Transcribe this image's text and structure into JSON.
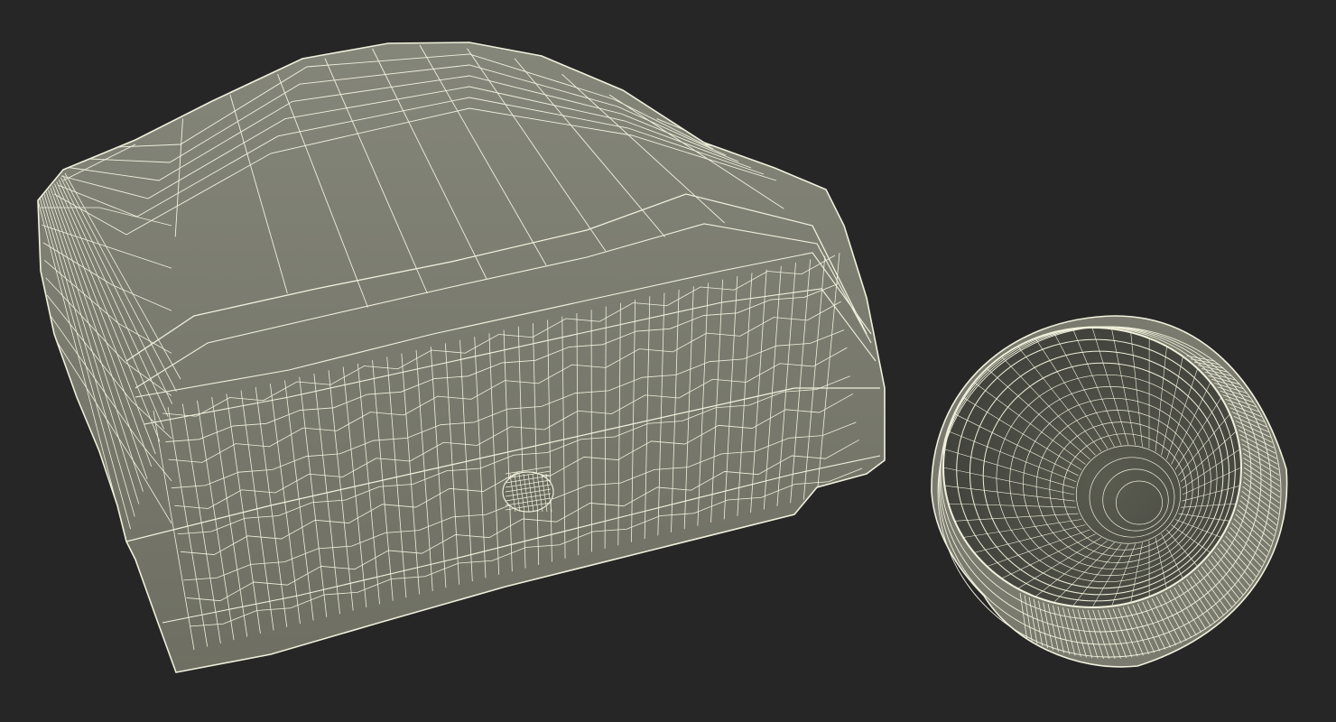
{
  "scene": {
    "background_color": "#262626",
    "surface_color": "#7d7e70",
    "surface_shadow_color": "#5e5f53",
    "wire_color": "#f0f0dc",
    "objects": [
      {
        "name": "container-body",
        "description_hidden": true
      },
      {
        "name": "bottle-cap",
        "description_hidden": true
      }
    ]
  }
}
